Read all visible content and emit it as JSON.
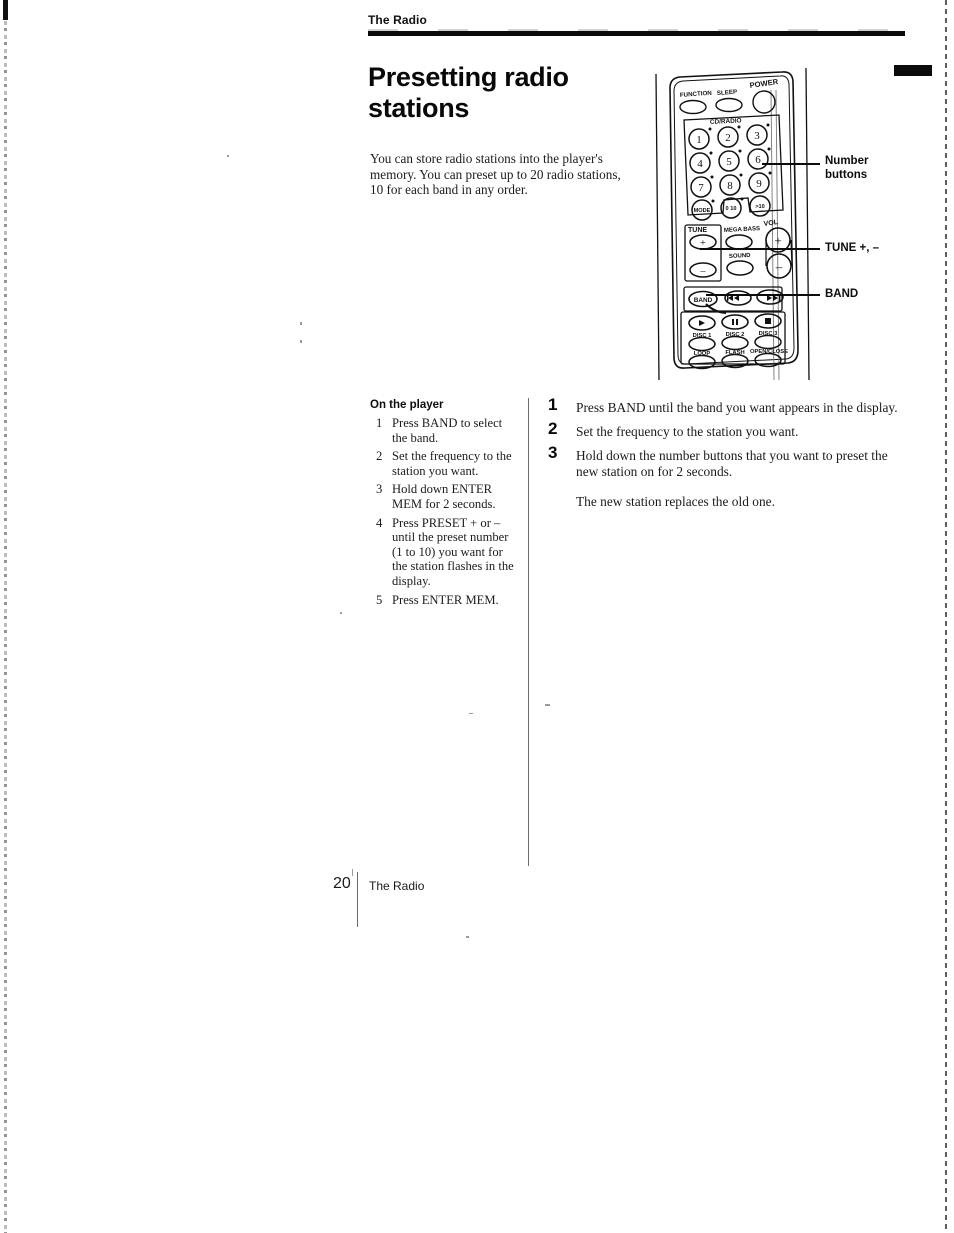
{
  "header": {
    "running_head": "The Radio",
    "title": "Presetting radio stations"
  },
  "intro": "You can store radio stations into the player's memory. You can preset up to 20 radio stations, 10 for each band in any order.",
  "left_column": {
    "heading": "On the player",
    "steps": [
      {
        "num": "1",
        "text": "Press BAND to select the band."
      },
      {
        "num": "2",
        "text": "Set the frequency to the station you want."
      },
      {
        "num": "3",
        "text": "Hold down ENTER MEM for 2 seconds."
      },
      {
        "num": "4",
        "text": "Press PRESET + or – until the preset number (1 to 10) you want for the station flashes in the display."
      },
      {
        "num": "5",
        "text": "Press ENTER MEM."
      }
    ]
  },
  "right_column": {
    "steps": [
      {
        "num": "1",
        "text": "Press BAND until the band you want appears in the display."
      },
      {
        "num": "2",
        "text": "Set the frequency to the station you want."
      },
      {
        "num": "3",
        "text": "Hold down the number buttons that you want to preset the new station on for 2 seconds."
      }
    ],
    "note": "The new station replaces the old one."
  },
  "callouts": {
    "number_buttons": "Number\nbuttons",
    "tune": "TUNE +, –",
    "band": "BAND"
  },
  "remote": {
    "top_row": [
      "FUNCTION",
      "SLEEP",
      "POWER"
    ],
    "keypad_label": "CD/RADIO",
    "keypad": [
      "1",
      "2",
      "3",
      "4",
      "5",
      "6",
      "7",
      "8",
      "9"
    ],
    "keypad_extra": [
      "MODE",
      "0 10",
      ">10"
    ],
    "tune_label": "TUNE",
    "tune_plus": "+",
    "tune_minus": "–",
    "mega_bass": "MEGA BASS",
    "sound": "SOUND",
    "vol_label": "VOL",
    "vol_plus": "+",
    "vol_minus": "–",
    "band": "BAND",
    "skip_back": "◀◀",
    "skip_fwd": "▶▶",
    "play": "▶",
    "pause": "‖",
    "stop": "■",
    "disc_labels": [
      "DISC 1",
      "DISC 2",
      "DISC 3"
    ],
    "bottom_labels": [
      "LOOP",
      "FLASH",
      "OPEN/CLOSE"
    ]
  },
  "footer": {
    "page_number": "20",
    "section": "The Radio"
  }
}
